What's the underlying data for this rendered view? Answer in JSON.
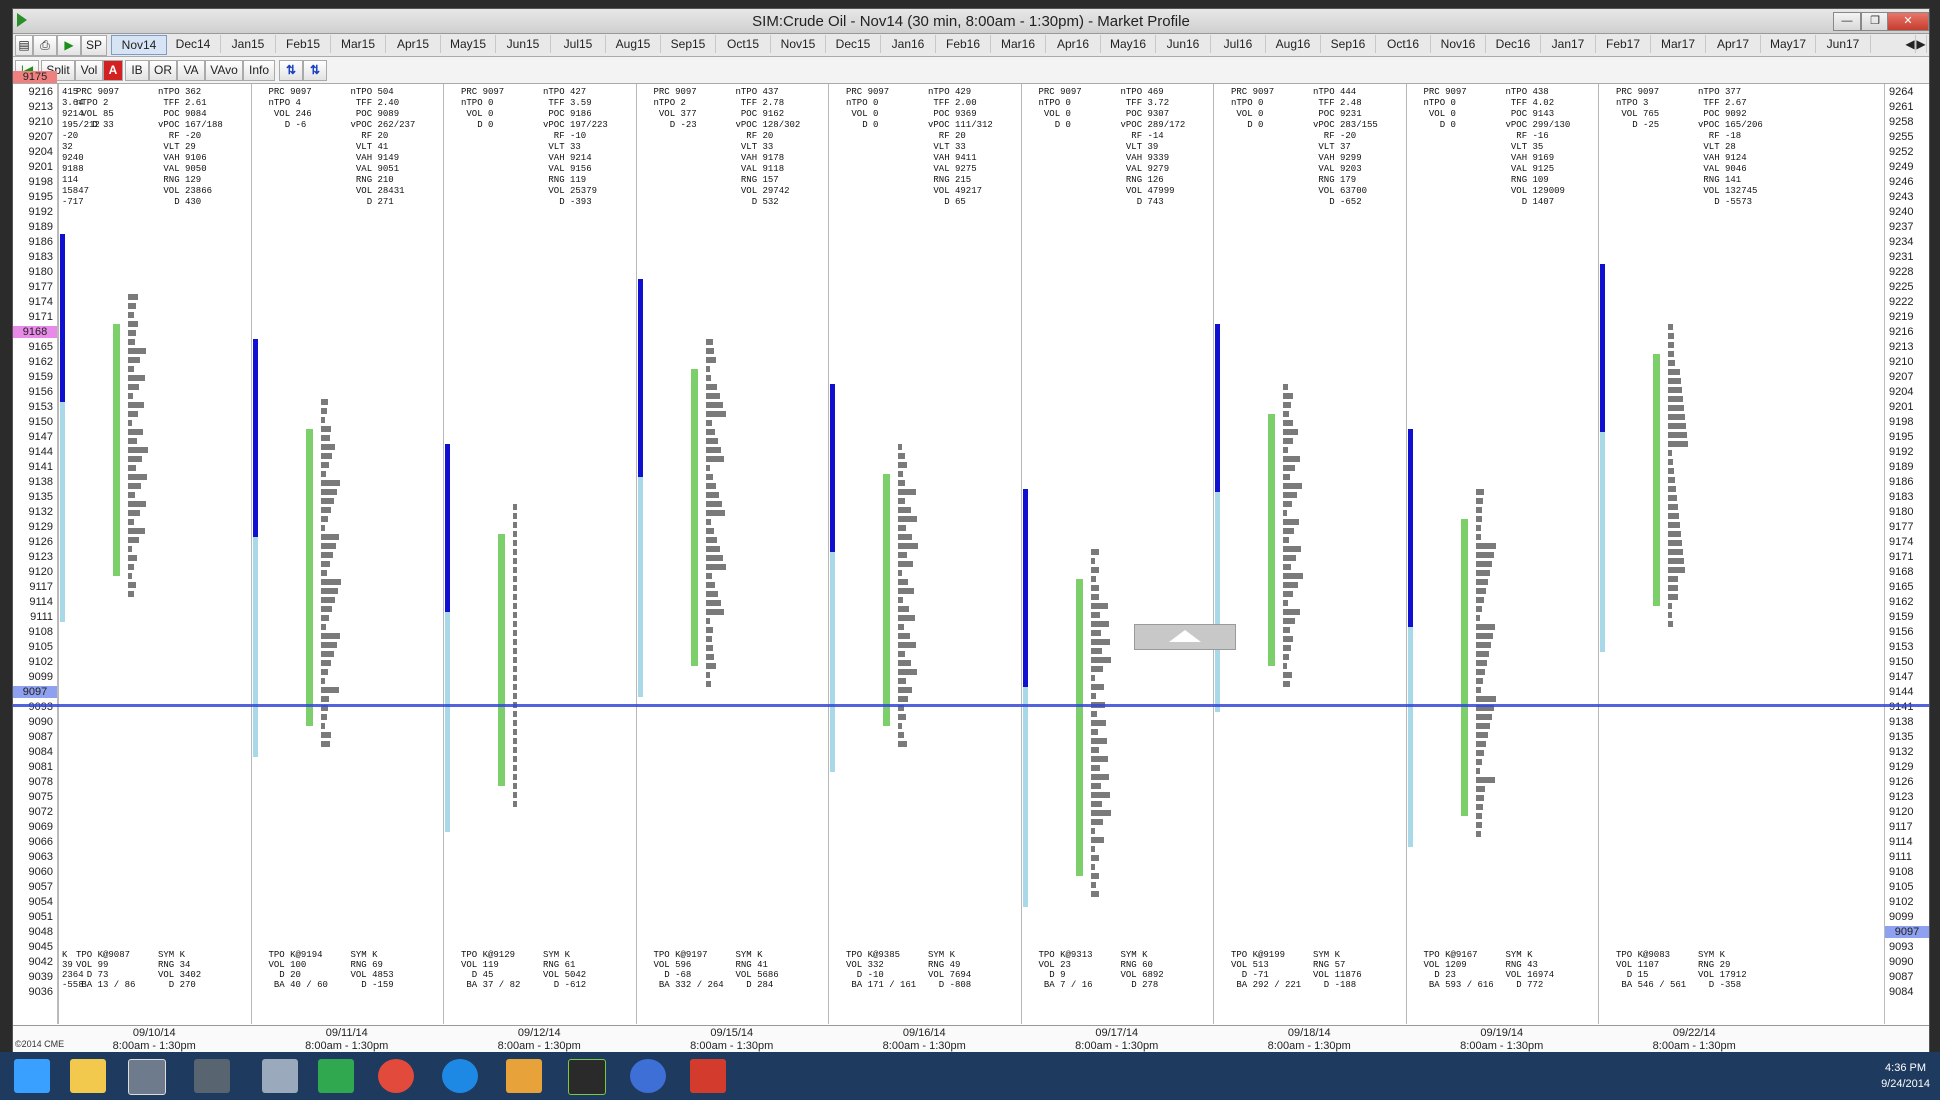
{
  "window": {
    "title": "SIM:Crude Oil - Nov14 (30 min, 8:00am - 1:30pm) - Market Profile",
    "min": "—",
    "max": "❐",
    "close": "✕"
  },
  "contracts": [
    "Nov14",
    "Dec14",
    "Jan15",
    "Feb15",
    "Mar15",
    "Apr15",
    "May15",
    "Jun15",
    "Jul15",
    "Aug15",
    "Sep15",
    "Oct15",
    "Nov15",
    "Dec15",
    "Jan16",
    "Feb16",
    "Mar16",
    "Apr16",
    "May16",
    "Jun16",
    "Jul16",
    "Aug16",
    "Sep16",
    "Oct16",
    "Nov16",
    "Dec16",
    "Jan17",
    "Feb17",
    "Mar17",
    "Apr17",
    "May17",
    "Jun17"
  ],
  "active_contract": "Nov14",
  "toolbar": {
    "sp": "SP",
    "split": "Split",
    "vol": "Vol",
    "a": "A",
    "ib": "IB",
    "or": "OR",
    "va": "VA",
    "vavo": "VAvo",
    "info": "Info",
    "arr1": "⇅",
    "arr2": "⇅"
  },
  "axis_left": [
    "9216",
    "9213",
    "9210",
    "9207",
    "9204",
    "9201",
    "9198",
    "9195",
    "9192",
    "9189",
    "9186",
    "9183",
    "9180",
    "9177",
    "9174",
    "9171",
    "9168",
    "9165",
    "9162",
    "9159",
    "9156",
    "9153",
    "9150",
    "9147",
    "9144",
    "9141",
    "9138",
    "9135",
    "9132",
    "9129",
    "9126",
    "9123",
    "9120",
    "9117",
    "9114",
    "9111",
    "9108",
    "9105",
    "9102",
    "9099",
    "9096",
    "9093",
    "9090",
    "9087",
    "9084",
    "9081",
    "9078",
    "9075",
    "9072",
    "9069",
    "9066",
    "9063",
    "9060",
    "9057",
    "9054",
    "9051",
    "9048",
    "9045",
    "9042",
    "9039",
    "9036"
  ],
  "axis_right": [
    "9264",
    "9261",
    "9258",
    "9255",
    "9252",
    "9249",
    "9246",
    "9243",
    "9240",
    "9237",
    "9234",
    "9231",
    "9228",
    "9225",
    "9222",
    "9219",
    "9216",
    "9213",
    "9210",
    "9207",
    "9204",
    "9201",
    "9198",
    "9195",
    "9192",
    "9189",
    "9186",
    "9183",
    "9180",
    "9177",
    "9174",
    "9171",
    "9168",
    "9165",
    "9162",
    "9159",
    "9156",
    "9153",
    "9150",
    "9147",
    "9144",
    "9141",
    "9138",
    "9135",
    "9132",
    "9129",
    "9126",
    "9123",
    "9120",
    "9117",
    "9114",
    "9111",
    "9108",
    "9105",
    "9102",
    "9099",
    "9096",
    "9093",
    "9090",
    "9087",
    "9084"
  ],
  "marks": {
    "red": "9175",
    "pink": "9168",
    "blue_left": "9097",
    "blue_right": "9097"
  },
  "sessions": [
    {
      "date": "09/10/14",
      "hours": "8:00am - 1:30pm",
      "top_left": "415\n3.64\n9214\n195/212\n-20\n32\n9240\n9188\n114\n15847\n-717",
      "top_mid": "PRC 9097\nnTPO 2\n VOL 85\n   D 33",
      "top_right": "nTPO 362\n TFF 2.61\n POC 9084\nvPOC 167/188\n  RF -20\n VLT 29\n VAH 9106\n VAL 9050\n RNG 129\n VOL 23866\n   D 430",
      "bot_left": "K\n39\n2364\n-558",
      "bot_mid": "TPO K@9087\nVOL 99\n  D 73\n BA 13 / 86",
      "bot_right": "SYM K\nRNG 34\nVOL 3402\n  D 270"
    },
    {
      "date": "09/11/14",
      "hours": "8:00am - 1:30pm",
      "top_left": "",
      "top_mid": "PRC 9097\nnTPO 4\n VOL 246\n   D -6",
      "top_right": "nTPO 504\n TFF 2.40\n POC 9089\nvPOC 262/237\n  RF 20\n VLT 41\n VAH 9149\n VAL 9051\n RNG 210\n VOL 28431\n   D 271",
      "bot_left": "",
      "bot_mid": "TPO K@9194\nVOL 100\n  D 20\n BA 40 / 60",
      "bot_right": "SYM K\nRNG 69\nVOL 4853\n  D -159"
    },
    {
      "date": "09/12/14",
      "hours": "8:00am - 1:30pm",
      "top_left": "",
      "top_mid": "PRC 9097\nnTPO 0\n VOL 0\n   D 0",
      "top_right": "nTPO 427\n TFF 3.59\n POC 9186\nvPOC 197/223\n  RF -10\n VLT 33\n VAH 9214\n VAL 9156\n RNG 119\n VOL 25379\n   D -393",
      "bot_left": "",
      "bot_mid": "TPO K@9129\nVOL 119\n  D 45\n BA 37 / 82",
      "bot_right": "SYM K\nRNG 61\nVOL 5042\n  D -612"
    },
    {
      "date": "09/15/14",
      "hours": "8:00am - 1:30pm",
      "top_left": "",
      "top_mid": "PRC 9097\nnTPO 2\n VOL 377\n   D -23",
      "top_right": "nTPO 437\n TFF 2.78\n POC 9162\nvPOC 128/302\n  RF 20\n VLT 33\n VAH 9178\n VAL 9118\n RNG 157\n VOL 29742\n   D 532",
      "bot_left": "",
      "bot_mid": "TPO K@9197\nVOL 596\n  D -68\n BA 332 / 264",
      "bot_right": "SYM K\nRNG 41\nVOL 5686\n  D 284"
    },
    {
      "date": "09/16/14",
      "hours": "8:00am - 1:30pm",
      "top_left": "",
      "top_mid": "PRC 9097\nnTPO 0\n VOL 0\n   D 0",
      "top_right": "nTPO 429\n TFF 2.00\n POC 9369\nvPOC 111/312\n  RF 20\n VLT 33\n VAH 9411\n VAL 9275\n RNG 215\n VOL 49217\n   D 65",
      "bot_left": "",
      "bot_mid": "TPO K@9385\nVOL 332\n  D -10\n BA 171 / 161",
      "bot_right": "SYM K\nRNG 49\nVOL 7694\n  D -808"
    },
    {
      "date": "09/17/14",
      "hours": "8:00am - 1:30pm",
      "top_left": "",
      "top_mid": "PRC 9097\nnTPO 0\n VOL 0\n   D 0",
      "top_right": "nTPO 469\n TFF 3.72\n POC 9307\nvPOC 289/172\n  RF -14\n VLT 39\n VAH 9339\n VAL 9279\n RNG 126\n VOL 47999\n   D 743",
      "bot_left": "",
      "bot_mid": "TPO K@9313\nVOL 23\n  D 9\n BA 7 / 16",
      "bot_right": "SYM K\nRNG 60\nVOL 6892\n  D 278"
    },
    {
      "date": "09/18/14",
      "hours": "8:00am - 1:30pm",
      "top_left": "",
      "top_mid": "PRC 9097\nnTPO 0\n VOL 0\n   D 0",
      "top_right": "nTPO 444\n TFF 2.48\n POC 9231\nvPOC 283/155\n  RF -20\n VLT 37\n VAH 9299\n VAL 9203\n RNG 179\n VOL 63700\n   D -652",
      "bot_left": "",
      "bot_mid": "TPO K@9199\nVOL 513\n  D -71\n BA 292 / 221",
      "bot_right": "SYM K\nRNG 57\nVOL 11876\n  D -188"
    },
    {
      "date": "09/19/14",
      "hours": "8:00am - 1:30pm",
      "top_left": "",
      "top_mid": "PRC 9097\nnTPO 0\n VOL 0\n   D 0",
      "top_right": "nTPO 438\n TFF 4.02\n POC 9143\nvPOC 299/130\n  RF -16\n VLT 35\n VAH 9169\n VAL 9125\n RNG 109\n VOL 129009\n   D 1407",
      "bot_left": "",
      "bot_mid": "TPO K@9167\nVOL 1209\n  D 23\n BA 593 / 616",
      "bot_right": "SYM K\nRNG 43\nVOL 16974\n  D 772"
    },
    {
      "date": "09/22/14",
      "hours": "8:00am - 1:30pm",
      "top_left": "",
      "top_mid": "PRC 9097\nnTPO 3\n VOL 765\n   D -25",
      "top_right": "nTPO 377\n TFF 2.67\n POC 9092\nvPOC 165/206\n  RF -18\n VLT 28\n VAH 9124\n VAL 9046\n RNG 141\n VOL 132745\n   D -5573",
      "bot_left": "",
      "bot_mid": "TPO K@9083\nVOL 1107\n  D 15\n BA 546 / 561",
      "bot_right": "SYM K\nRNG 29\nVOL 17912\n  D -358"
    }
  ],
  "copyright": "©2014 CME",
  "taskbar": {
    "time": "4:36 PM",
    "date": "9/24/2014"
  },
  "colors": {
    "poc_blue": "#1010d0",
    "va_lightblue": "#a9d8e8",
    "ib_green": "#7ccf6a",
    "histogram": "#7a7a7a",
    "cur_price_line": "#3548d8"
  }
}
